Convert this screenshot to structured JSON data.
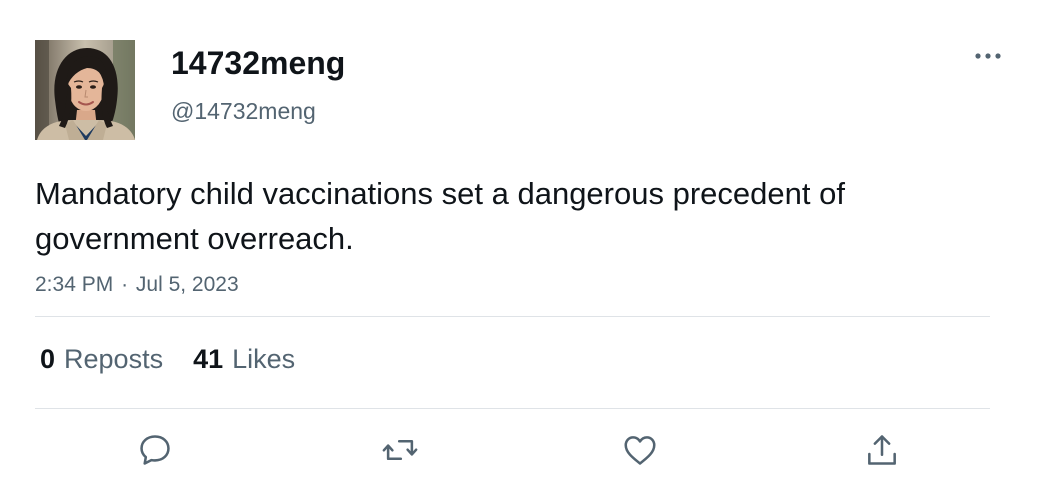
{
  "tweet": {
    "author": {
      "display_name": "14732meng",
      "handle": "@14732meng",
      "avatar_icon": "profile-photo"
    },
    "text": "Mandatory child vaccinations set a dangerous precedent of government overreach.",
    "time": "2:34 PM",
    "separator": "·",
    "date": "Jul 5, 2023",
    "stats": {
      "reposts_count": "0",
      "reposts_label": "Reposts",
      "likes_count": "41",
      "likes_label": "Likes"
    },
    "actions": [
      {
        "name": "reply",
        "icon": "speech-bubble-icon"
      },
      {
        "name": "repost",
        "icon": "repost-arrows-icon"
      },
      {
        "name": "like",
        "icon": "heart-icon"
      },
      {
        "name": "share",
        "icon": "share-upload-icon"
      }
    ],
    "more_icon": "more-dots-icon"
  },
  "colors": {
    "text_primary": "#0f1419",
    "text_secondary": "#536471",
    "divider": "#dfe3e7",
    "icon": "#536471"
  }
}
